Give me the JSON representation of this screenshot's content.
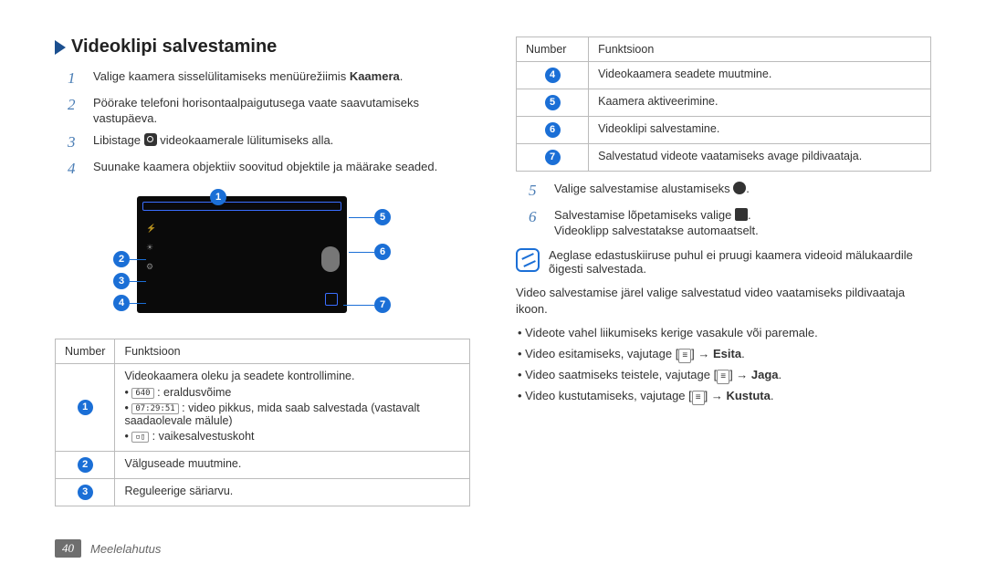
{
  "heading": "Videoklipi salvestamine",
  "steps_left": [
    {
      "num": "1",
      "pre": "Valige kaamera sisselülitamiseks menüürežiimis ",
      "bold": "Kaamera",
      "post": "."
    },
    {
      "num": "2",
      "pre": "Pöörake telefoni horisontaalpaigutusega vaate saavutamiseks vastupäeva.",
      "bold": "",
      "post": ""
    },
    {
      "num": "3",
      "pre": "Libistage ",
      "icon": "cam",
      "mid": " videokaamerale lülitumiseks alla.",
      "bold": "",
      "post": ""
    },
    {
      "num": "4",
      "pre": "Suunake kaamera objektiiv soovitud objektile ja määrake seaded.",
      "bold": "",
      "post": ""
    }
  ],
  "table_left": {
    "headers": [
      "Number",
      "Funktsioon"
    ],
    "rows": [
      {
        "n": "1",
        "text": "Videokaamera oleku ja seadete kontrollimine.",
        "items": [
          {
            "icon": "640",
            "text": " : eraldusvõime"
          },
          {
            "icon": "07:29:51",
            "text": " : video pikkus, mida saab salvestada (vastavalt saadaolevale mälule)"
          },
          {
            "icon": "▫▯",
            "text": " : vaikesalvestuskoht"
          }
        ]
      },
      {
        "n": "2",
        "text": "Välguseade muutmine."
      },
      {
        "n": "3",
        "text": "Reguleerige säriarvu."
      }
    ]
  },
  "table_right": {
    "headers": [
      "Number",
      "Funktsioon"
    ],
    "rows": [
      {
        "n": "4",
        "text": "Videokaamera seadete muutmine."
      },
      {
        "n": "5",
        "text": "Kaamera aktiveerimine."
      },
      {
        "n": "6",
        "text": "Videoklipi salvestamine."
      },
      {
        "n": "7",
        "text": "Salvestatud videote vaatamiseks avage pildivaataja."
      }
    ]
  },
  "steps_right": [
    {
      "num": "5",
      "pre": "Valige salvestamise alustamiseks "
    },
    {
      "num": "6",
      "pre": "Salvestamise lõpetamiseks valige "
    }
  ],
  "auto_save": "Videoklipp salvestatakse automaatselt.",
  "note": "Aeglase edastuskiiruse puhul ei pruugi kaamera videoid mälukaardile õigesti salvestada.",
  "after_note": "Video salvestamise järel valige salvestatud video vaatamiseks pildivaataja ikoon.",
  "bullets": [
    {
      "text": "Videote vahel liikumiseks kerige vasakule või paremale."
    },
    {
      "text": "Video esitamiseks, vajutage [",
      "menu": true,
      "post": "] → ",
      "bold": "Esita",
      "end": "."
    },
    {
      "text": "Video saatmiseks teistele, vajutage [",
      "menu": true,
      "post": "] → ",
      "bold": "Jaga",
      "end": "."
    },
    {
      "text": "Video kustutamiseks, vajutage [",
      "menu": true,
      "post": "] → ",
      "bold": "Kustuta",
      "end": "."
    }
  ],
  "footer": {
    "page": "40",
    "section": "Meelelahutus"
  }
}
